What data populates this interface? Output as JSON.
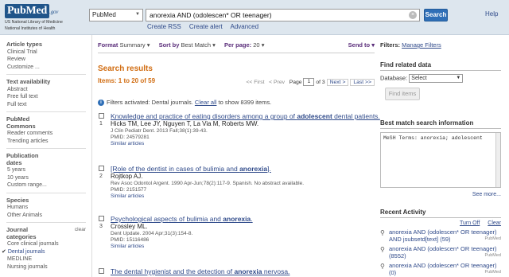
{
  "header": {
    "logo_pub": "Pub",
    "logo_med": "Med",
    "logo_gov": ".gov",
    "logo_line1": "US National Library of Medicine",
    "logo_line2": "National Institutes of Health",
    "db_select_value": "PubMed",
    "search_value": "anorexia AND (odolescen* OR teenager)",
    "search_button": "Search",
    "help_link": "Help",
    "sublinks": [
      "Create RSS",
      "Create alert",
      "Advanced"
    ]
  },
  "sidebar": {
    "groups": [
      {
        "title": "Article types",
        "items": [
          "Clinical Trial",
          "Review",
          "Customize ..."
        ]
      },
      {
        "title": "Text availability",
        "items": [
          "Abstract",
          "Free full text",
          "Full text"
        ]
      },
      {
        "title": "PubMed Commons",
        "items": [
          "Reader comments",
          "Trending articles"
        ]
      },
      {
        "title": "Publication dates",
        "items": [
          "5 years",
          "10 years",
          "Custom range..."
        ]
      },
      {
        "title": "Species",
        "items": [
          "Humans",
          "Other Animals"
        ]
      },
      {
        "title": "Journal categories",
        "clear": "clear",
        "items": [
          "Core clinical journals",
          "Dental journals",
          "MEDLINE",
          "Nursing journals"
        ],
        "selected_index": 1
      }
    ]
  },
  "main": {
    "format_label": "Format",
    "format_value": "Summary",
    "sort_label": "Sort by",
    "sort_value": "Best Match",
    "perpage_label": "Per page:",
    "perpage_value": "20",
    "send_to": "Send to",
    "results_title": "Search results",
    "items_label": "Items: 1 to 20 of 59",
    "pager": {
      "first": "<< First",
      "prev": "< Prev",
      "page_label": "Page",
      "page_value": "1",
      "of": "of 3",
      "next": "Next >",
      "last": "Last >>"
    },
    "filter_note_prefix": "Filters activated: Dental journals.",
    "filter_clear_all": "Clear all",
    "filter_note_suffix": "to show 8399 items.",
    "results": [
      {
        "num": "1",
        "title_before": "Knowledge and practice of eating disorders among a group of ",
        "title_bold": "adolescent",
        "title_after": " dental patients.",
        "authors": "Hicks TM, Lee JY, Nguyen T, La Via M, Roberts MW.",
        "source": "J Clin Pediatr Dent. 2013 Fall;38(1):39-43.",
        "pmid": "PMID: 24579281",
        "similar": "Similar articles"
      },
      {
        "num": "2",
        "title_before": "[Role of the dentist in cases of bulimia and ",
        "title_bold": "anorexia",
        "title_after": "].",
        "authors": "Rojtkop AJ.",
        "source": "Rev Asoc Odontol Argent. 1990 Apr-Jun;78(2):117-9. Spanish. No abstract available.",
        "pmid": "PMID: 2151577",
        "similar": "Similar articles"
      },
      {
        "num": "3",
        "title_before": "Psychological aspects of bulimia and ",
        "title_bold": "anorexia",
        "title_after": ".",
        "authors": "Crossley ML.",
        "source": "Dent Update. 2004 Apr;31(3):154-8.",
        "pmid": "PMID: 15116486",
        "similar": "Similar articles"
      },
      {
        "num": "4",
        "title_before": "The dental hygienist and the detection of ",
        "title_bold": "anorexia",
        "title_after": " nervosa.",
        "authors": "",
        "source": "",
        "pmid": "",
        "similar": ""
      }
    ]
  },
  "right": {
    "filters_label": "Filters:",
    "manage_filters": "Manage Filters",
    "related_title": "Find related data",
    "database_label": "Database:",
    "database_value": "Select",
    "find_items": "Find items",
    "best_match_title": "Best match search information",
    "mesh_text": "MeSH Terms: anorexia; adolescent",
    "see_more": "See more...",
    "recent_title": "Recent Activity",
    "turn_off": "Turn Off",
    "clear": "Clear",
    "activities": [
      {
        "text": "anorexia AND (odolescen* OR teenager) AND jsubsetd[text] (59)",
        "tag": "PubMed"
      },
      {
        "text": "anorexia AND (odolescen* OR teenager) (8552)",
        "tag": "PubMed"
      },
      {
        "text": "anorexia AND (odolescen* OR teenager) (0)",
        "tag": "PubMed"
      }
    ]
  }
}
